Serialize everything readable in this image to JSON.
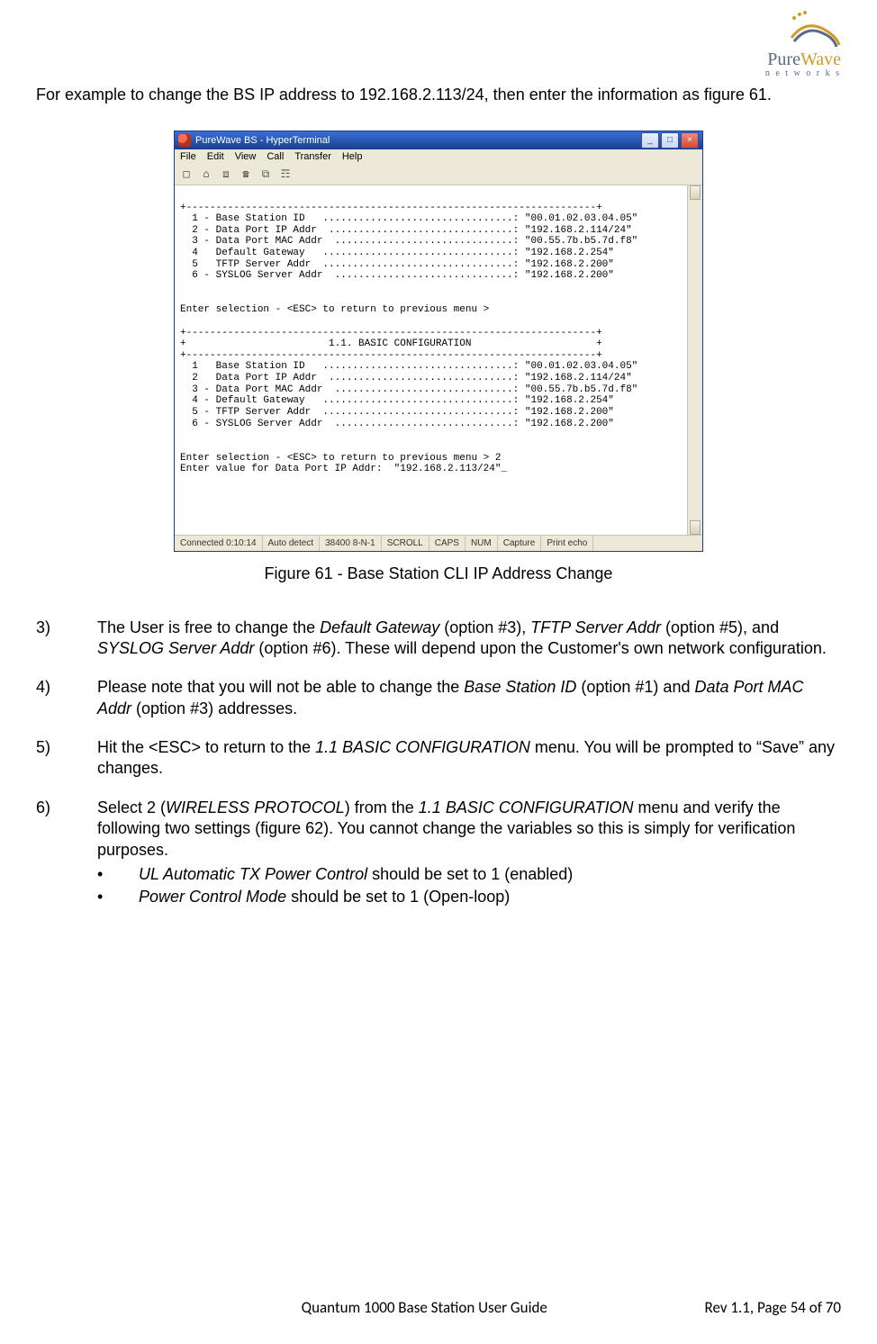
{
  "logo": {
    "brand_pure": "Pure",
    "brand_wave": "Wave",
    "sub": "n e t w o r k s"
  },
  "intro": "For example to change the BS IP address to 192.168.2.113/24, then enter the information as figure 61.",
  "window": {
    "title": "PureWave BS - HyperTerminal",
    "menu": [
      "File",
      "Edit",
      "View",
      "Call",
      "Transfer",
      "Help"
    ],
    "terminal_lines": [
      "+---------------------------------------------------------------------+",
      "  1 - Base Station ID   ................................: \"00.01.02.03.04.05\"",
      "  2 - Data Port IP Addr  ...............................: \"192.168.2.114/24\"",
      "  3 - Data Port MAC Addr  ..............................: \"00.55.7b.b5.7d.f8\"",
      "  4   Default Gateway   ................................: \"192.168.2.254\"",
      "  5   TFTP Server Addr  ................................: \"192.168.2.200\"",
      "  6 - SYSLOG Server Addr  ..............................: \"192.168.2.200\"",
      "",
      "",
      "Enter selection - <ESC> to return to previous menu >",
      "",
      "+---------------------------------------------------------------------+",
      "+                        1.1. BASIC CONFIGURATION                     +",
      "+---------------------------------------------------------------------+",
      "  1   Base Station ID   ................................: \"00.01.02.03.04.05\"",
      "  2   Data Port IP Addr  ...............................: \"192.168.2.114/24\"",
      "  3 - Data Port MAC Addr  ..............................: \"00.55.7b.b5.7d.f8\"",
      "  4 - Default Gateway   ................................: \"192.168.2.254\"",
      "  5 - TFTP Server Addr  ................................: \"192.168.2.200\"",
      "  6 - SYSLOG Server Addr  ..............................: \"192.168.2.200\"",
      "",
      "",
      "Enter selection - <ESC> to return to previous menu > 2",
      "Enter value for Data Port IP Addr:  \"192.168.2.113/24\"_"
    ],
    "status": [
      "Connected 0:10:14",
      "Auto detect",
      "38400 8-N-1",
      "SCROLL",
      "CAPS",
      "NUM",
      "Capture",
      "Print echo"
    ]
  },
  "caption": "Figure 61 - Base Station CLI IP Address Change",
  "steps": {
    "s3": {
      "pre": "The User is free to change the ",
      "i1": "Default Gateway",
      "mid1": " (option #3), ",
      "i2": "TFTP Server Addr",
      "mid2": " (option #5), and ",
      "i3": "SYSLOG Server Addr",
      "post": " (option #6). These will depend upon the Customer's own network configuration."
    },
    "s4": {
      "pre": "Please note that you will not be able to change the ",
      "i1": "Base Station ID",
      "mid1": " (option #1) and ",
      "i2": "Data Port MAC Addr",
      "post": " (option #3) addresses."
    },
    "s5": {
      "pre": "Hit the <ESC> to return to the ",
      "i1": "1.1 BASIC CONFIGURATION",
      "post": " menu. You will be prompted to “Save” any changes."
    },
    "s6": {
      "pre": "Select 2 (",
      "i1": "WIRELESS PROTOCOL",
      "mid1": ") from the ",
      "i2": "1.1 BASIC CONFIGURATION",
      "post": " menu and verify the following two settings (figure 62). You cannot change the variables so this is simply for verification purposes.",
      "b1_i": "UL Automatic TX Power Control",
      "b1_t": " should be set to 1 (enabled)",
      "b2_i": "Power Control Mode",
      "b2_t": " should be set to 1 (Open-loop)"
    }
  },
  "footer": {
    "center": "Quantum 1000 Base Station User Guide",
    "right": "Rev 1.1, Page 54 of 70"
  }
}
